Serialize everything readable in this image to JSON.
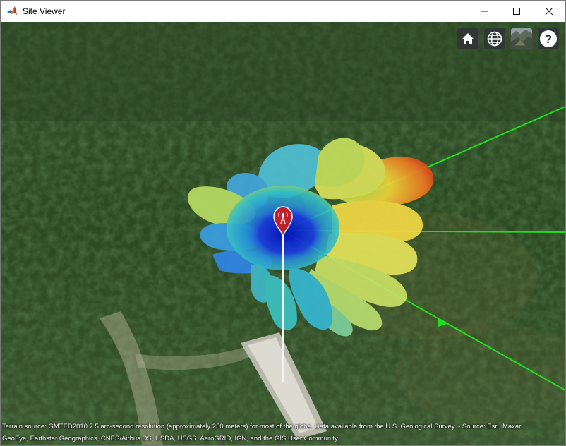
{
  "window": {
    "title": "Site Viewer",
    "controls": [
      "minimize",
      "maximize",
      "close"
    ]
  },
  "toolbar": {
    "buttons": [
      {
        "name": "home",
        "icon": "home-icon"
      },
      {
        "name": "scene-mode",
        "icon": "globe-icon"
      },
      {
        "name": "basemap",
        "icon": "basemap-icon"
      },
      {
        "name": "help",
        "icon": "help-icon",
        "label": "?"
      }
    ]
  },
  "attribution": {
    "line1": "Terrain source: GMTED2010 7.5 arc-second resolution (approximately 250 meters) for most of the globe. Data available from the U.S. Geological Survey. - Source: Esri, Maxar,",
    "line2": "GeoEye, Earthstar Geographics, CNES/Airbus DS, USDA, USGS, AeroGRID, IGN, and the GIS User Community"
  },
  "colors": {
    "ray_green": "#1fe01f",
    "marker_red": "#c0202a",
    "pattern_low": "#0a1ad6",
    "pattern_high": "#e02a14"
  }
}
